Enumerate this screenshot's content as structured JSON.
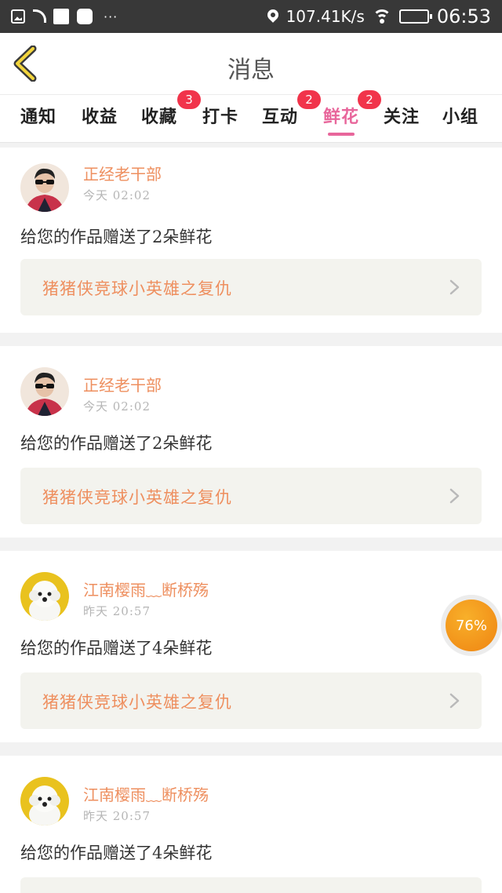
{
  "status_bar": {
    "dots": "···",
    "speed": "107.41K/s",
    "time": "06:53",
    "battery_fraction": 0.45
  },
  "header": {
    "title": "消息",
    "back_icon": "chevron-left-icon",
    "accent_color": "#e8669b"
  },
  "tabs": [
    {
      "label": "通知",
      "badge": ""
    },
    {
      "label": "收益",
      "badge": ""
    },
    {
      "label": "收藏",
      "badge": "3"
    },
    {
      "label": "打卡",
      "badge": ""
    },
    {
      "label": "互动",
      "badge": "2"
    },
    {
      "label": "鲜花",
      "badge": "2",
      "active": true
    },
    {
      "label": "关注",
      "badge": ""
    },
    {
      "label": "小组",
      "badge": ""
    }
  ],
  "messages": [
    {
      "user": "正经老干部",
      "time": "今天 02:02",
      "text": "给您的作品赠送了2朵鲜花",
      "work": "猪猪侠竞球小英雄之复仇",
      "avatar": "person-avatar"
    },
    {
      "user": "正经老干部",
      "time": "今天 02:02",
      "text": "给您的作品赠送了2朵鲜花",
      "work": "猪猪侠竞球小英雄之复仇",
      "avatar": "person-avatar"
    },
    {
      "user": "江南樱雨﹏断桥殇",
      "time": "昨天 20:57",
      "text": "给您的作品赠送了4朵鲜花",
      "work": "猪猪侠竞球小英雄之复仇",
      "avatar": "dog-avatar"
    },
    {
      "user": "江南樱雨﹏断桥殇",
      "time": "昨天 20:57",
      "text": "给您的作品赠送了4朵鲜花",
      "work": "",
      "avatar": "dog-avatar"
    }
  ],
  "floating": {
    "percent": "76%"
  }
}
